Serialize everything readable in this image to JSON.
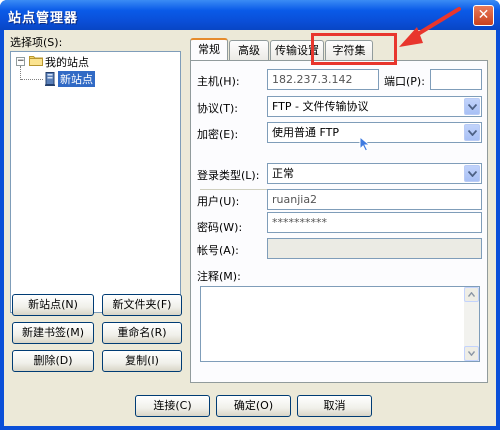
{
  "window": {
    "title": "站点管理器",
    "close_glyph": "✕"
  },
  "left_panel": {
    "select_label": "选择项(S):",
    "tree": {
      "root": {
        "label": "我的站点",
        "icon": "folder-icon",
        "expander": "−"
      },
      "child": {
        "label": "新站点",
        "icon": "server-icon",
        "selected": true
      }
    },
    "buttons": {
      "new_site": "新站点(N)",
      "new_folder": "新文件夹(F)",
      "new_bookmark": "新建书签(M)",
      "rename": "重命名(R)",
      "delete": "删除(D)",
      "copy": "复制(I)"
    }
  },
  "tabs": [
    {
      "label": "常规",
      "active": true
    },
    {
      "label": "高级",
      "active": false
    },
    {
      "label": "传输设置",
      "active": false
    },
    {
      "label": "字符集",
      "active": false
    }
  ],
  "general": {
    "host_label": "主机(H):",
    "host_value": "182.237.3.142",
    "port_label": "端口(P):",
    "port_value": "",
    "protocol_label": "协议(T):",
    "protocol_value": "FTP - 文件传输协议",
    "encryption_label": "加密(E):",
    "encryption_value": "使用普通 FTP",
    "logon_type_label": "登录类型(L):",
    "logon_type_value": "正常",
    "user_label": "用户(U):",
    "user_value": "ruanjia2",
    "password_label": "密码(W):",
    "password_value": "**********",
    "account_label": "帐号(A):",
    "account_value": "",
    "comments_label": "注释(M):",
    "comments_value": ""
  },
  "footer": {
    "connect": "连接(C)",
    "ok": "确定(O)",
    "cancel": "取消"
  },
  "annotation": {
    "color": "#e8362d"
  }
}
